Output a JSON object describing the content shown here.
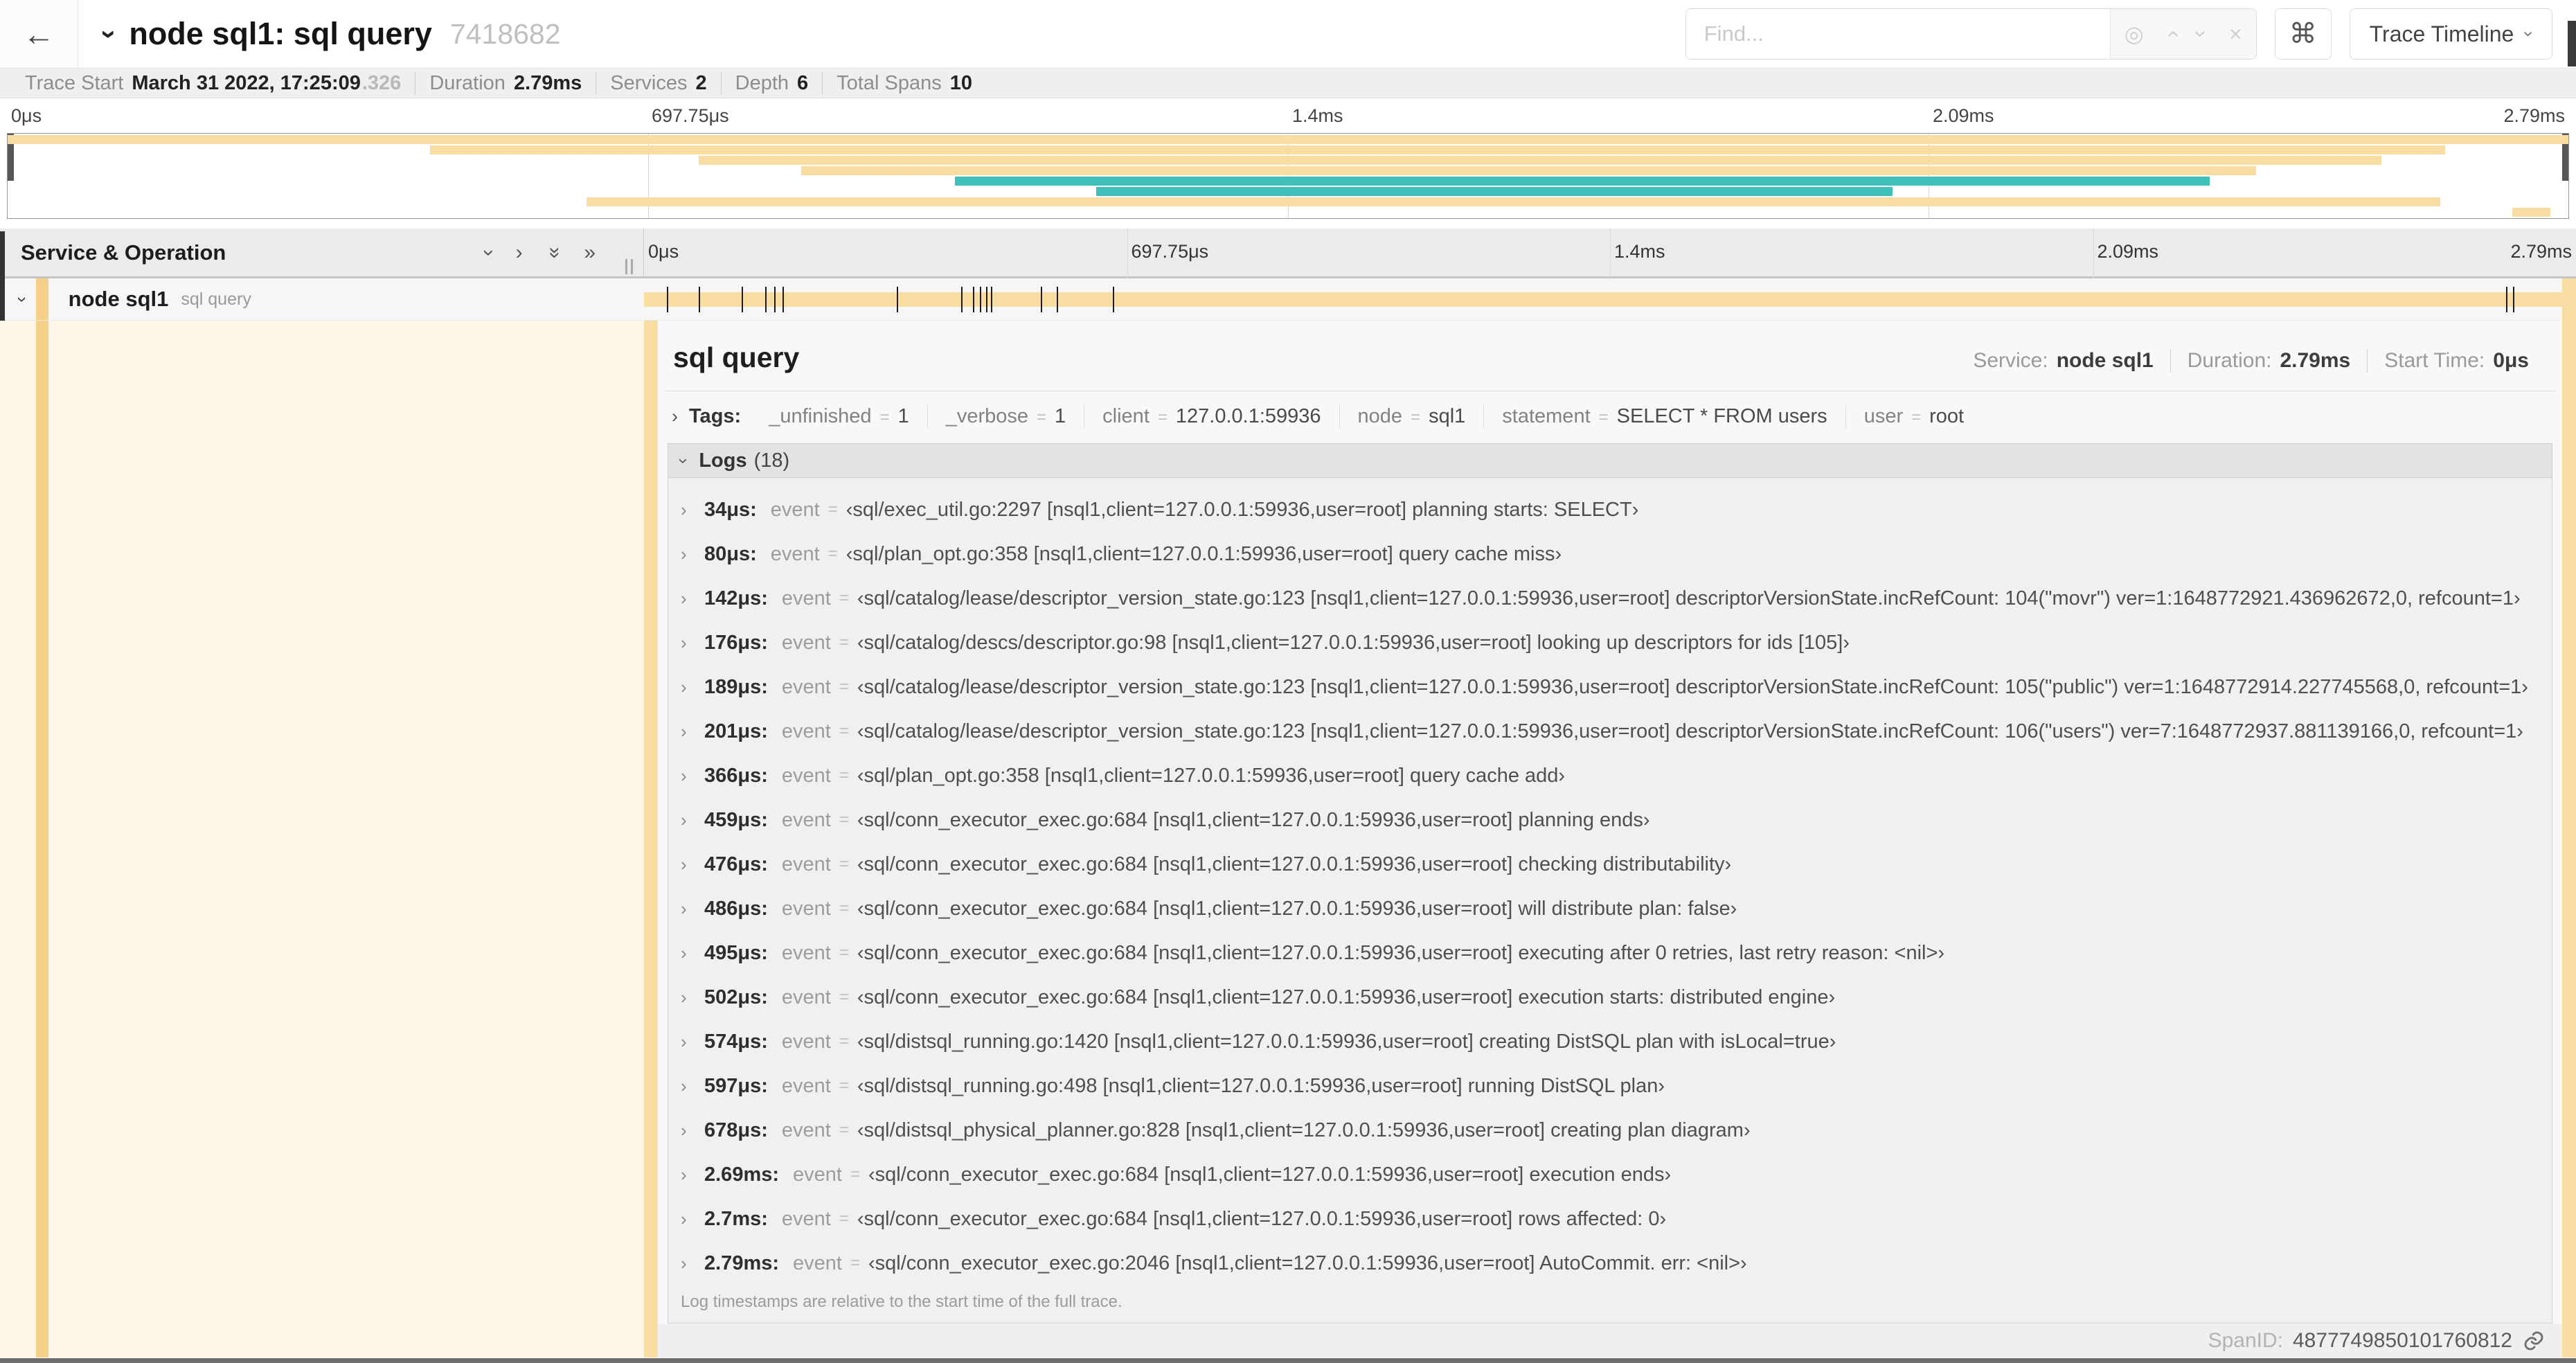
{
  "header": {
    "back_arrow": "←",
    "title": "node sql1: sql query",
    "trace_id": "7418682",
    "find_placeholder": "Find...",
    "shortcut_button": "⌘",
    "view_button": "Trace Timeline"
  },
  "infobar": {
    "items": [
      {
        "label": "Trace Start",
        "value": "March 31 2022, 17:25:09",
        "suffix": ".326"
      },
      {
        "label": "Duration",
        "value": "2.79ms"
      },
      {
        "label": "Services",
        "value": "2"
      },
      {
        "label": "Depth",
        "value": "6"
      },
      {
        "label": "Total Spans",
        "value": "10"
      }
    ]
  },
  "timeline": {
    "total_us": 2790,
    "ticks": [
      {
        "label": "0μs",
        "pct": 0
      },
      {
        "label": "697.75μs",
        "pct": 25
      },
      {
        "label": "1.4ms",
        "pct": 50
      },
      {
        "label": "2.09ms",
        "pct": 75
      },
      {
        "label": "2.79ms",
        "pct": 100
      }
    ]
  },
  "minimap": {
    "bars": [
      {
        "row": 0,
        "start": 0,
        "end": 100,
        "color": "tan"
      },
      {
        "row": 1,
        "start": 16.5,
        "end": 95.2,
        "color": "tan"
      },
      {
        "row": 2,
        "start": 27,
        "end": 92.7,
        "color": "tan"
      },
      {
        "row": 3,
        "start": 31,
        "end": 87.8,
        "color": "tan"
      },
      {
        "row": 4,
        "start": 37,
        "end": 86,
        "color": "teal"
      },
      {
        "row": 5,
        "start": 42.5,
        "end": 73.6,
        "color": "teal"
      },
      {
        "row": 6,
        "start": 22.6,
        "end": 95,
        "color": "tan"
      },
      {
        "row": 7,
        "start": 97.8,
        "end": 99.3,
        "color": "tan"
      }
    ]
  },
  "left_panel": {
    "header": "Service & Operation",
    "row": {
      "service": "node sql1",
      "operation": "sql query"
    }
  },
  "detail": {
    "title": "sql query",
    "meta": [
      {
        "label": "Service:",
        "value": "node sql1"
      },
      {
        "label": "Duration:",
        "value": "2.79ms"
      },
      {
        "label": "Start Time:",
        "value": "0μs"
      }
    ],
    "tags_label": "Tags:",
    "tags": [
      {
        "key": "_unfinished",
        "value": "1"
      },
      {
        "key": "_verbose",
        "value": "1"
      },
      {
        "key": "client",
        "value": "127.0.0.1:59936"
      },
      {
        "key": "node",
        "value": "sql1"
      },
      {
        "key": "statement",
        "value": "SELECT * FROM users"
      },
      {
        "key": "user",
        "value": "root"
      }
    ],
    "logs_label": "Logs",
    "logs_count": "(18)",
    "event_key": "event",
    "logs": [
      {
        "time": "34μs:",
        "t_us": 34,
        "event": "‹sql/exec_util.go:2297 [nsql1,client=127.0.0.1:59936,user=root] planning starts: SELECT›"
      },
      {
        "time": "80μs:",
        "t_us": 80,
        "event": "‹sql/plan_opt.go:358 [nsql1,client=127.0.0.1:59936,user=root] query cache miss›"
      },
      {
        "time": "142μs:",
        "t_us": 142,
        "event": "‹sql/catalog/lease/descriptor_version_state.go:123 [nsql1,client=127.0.0.1:59936,user=root] descriptorVersionState.incRefCount: 104(\"movr\") ver=1:1648772921.436962672,0, refcount=1›"
      },
      {
        "time": "176μs:",
        "t_us": 176,
        "event": "‹sql/catalog/descs/descriptor.go:98 [nsql1,client=127.0.0.1:59936,user=root] looking up descriptors for ids [105]›"
      },
      {
        "time": "189μs:",
        "t_us": 189,
        "event": "‹sql/catalog/lease/descriptor_version_state.go:123 [nsql1,client=127.0.0.1:59936,user=root] descriptorVersionState.incRefCount: 105(\"public\") ver=1:1648772914.227745568,0, refcount=1›"
      },
      {
        "time": "201μs:",
        "t_us": 201,
        "event": "‹sql/catalog/lease/descriptor_version_state.go:123 [nsql1,client=127.0.0.1:59936,user=root] descriptorVersionState.incRefCount: 106(\"users\") ver=7:1648772937.881139166,0, refcount=1›"
      },
      {
        "time": "366μs:",
        "t_us": 366,
        "event": "‹sql/plan_opt.go:358 [nsql1,client=127.0.0.1:59936,user=root] query cache add›"
      },
      {
        "time": "459μs:",
        "t_us": 459,
        "event": "‹sql/conn_executor_exec.go:684 [nsql1,client=127.0.0.1:59936,user=root] planning ends›"
      },
      {
        "time": "476μs:",
        "t_us": 476,
        "event": "‹sql/conn_executor_exec.go:684 [nsql1,client=127.0.0.1:59936,user=root] checking distributability›"
      },
      {
        "time": "486μs:",
        "t_us": 486,
        "event": "‹sql/conn_executor_exec.go:684 [nsql1,client=127.0.0.1:59936,user=root] will distribute plan: false›"
      },
      {
        "time": "495μs:",
        "t_us": 495,
        "event": "‹sql/conn_executor_exec.go:684 [nsql1,client=127.0.0.1:59936,user=root] executing after 0 retries, last retry reason: <nil>›"
      },
      {
        "time": "502μs:",
        "t_us": 502,
        "event": "‹sql/conn_executor_exec.go:684 [nsql1,client=127.0.0.1:59936,user=root] execution starts: distributed engine›"
      },
      {
        "time": "574μs:",
        "t_us": 574,
        "event": "‹sql/distsql_running.go:1420 [nsql1,client=127.0.0.1:59936,user=root] creating DistSQL plan with isLocal=true›"
      },
      {
        "time": "597μs:",
        "t_us": 597,
        "event": "‹sql/distsql_running.go:498 [nsql1,client=127.0.0.1:59936,user=root] running DistSQL plan›"
      },
      {
        "time": "678μs:",
        "t_us": 678,
        "event": "‹sql/distsql_physical_planner.go:828 [nsql1,client=127.0.0.1:59936,user=root] creating plan diagram›"
      },
      {
        "time": "2.69ms:",
        "t_us": 2690,
        "event": "‹sql/conn_executor_exec.go:684 [nsql1,client=127.0.0.1:59936,user=root] execution ends›"
      },
      {
        "time": "2.7ms:",
        "t_us": 2700,
        "event": "‹sql/conn_executor_exec.go:684 [nsql1,client=127.0.0.1:59936,user=root] rows affected: 0›"
      },
      {
        "time": "2.79ms:",
        "t_us": 2790,
        "event": "‹sql/conn_executor_exec.go:2046 [nsql1,client=127.0.0.1:59936,user=root] AutoCommit. err: <nil>›"
      }
    ],
    "logs_note": "Log timestamps are relative to the start time of the full trace.",
    "footer": {
      "label": "SpanID:",
      "value": "4877749850101760812"
    }
  },
  "colors": {
    "tan": "#f8dda2",
    "teal": "#3fc0ba",
    "accent": "#f5d088",
    "cream": "#fdf6e7"
  }
}
